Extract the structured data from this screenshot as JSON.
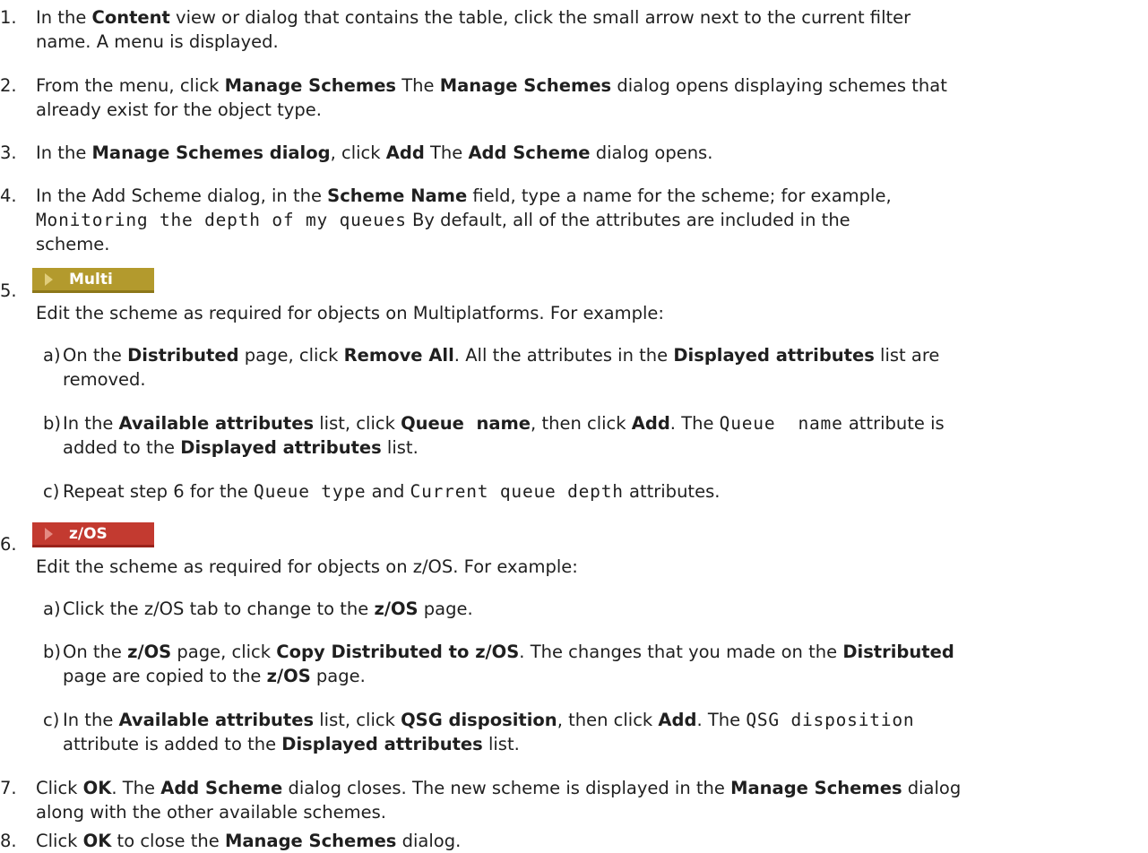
{
  "steps": [
    {
      "number": "1.",
      "lines": [
        [
          {
            "t": "In the "
          },
          {
            "t": "Content",
            "b": true
          },
          {
            "t": " view or dialog that contains the table, click the small arrow next to the current filter"
          }
        ],
        [
          {
            "t": "name. A menu is displayed."
          }
        ]
      ]
    },
    {
      "number": "2.",
      "lines": [
        [
          {
            "t": "From the menu, click "
          },
          {
            "t": "Manage Schemes",
            "b": true
          },
          {
            "t": " The "
          },
          {
            "t": "Manage Schemes",
            "b": true
          },
          {
            "t": " dialog opens displaying schemes that"
          }
        ],
        [
          {
            "t": "already exist for the object type."
          }
        ]
      ]
    },
    {
      "number": "3.",
      "lines": [
        [
          {
            "t": "In the "
          },
          {
            "t": "Manage Schemes dialog",
            "b": true
          },
          {
            "t": ", click "
          },
          {
            "t": "Add",
            "b": true
          },
          {
            "t": " The "
          },
          {
            "t": "Add Scheme",
            "b": true
          },
          {
            "t": " dialog opens."
          }
        ]
      ]
    },
    {
      "number": "4.",
      "lines": [
        [
          {
            "t": "In the Add Scheme dialog, in the "
          },
          {
            "t": "Scheme Name",
            "b": true
          },
          {
            "t": " field, type a name for the scheme; for example,"
          }
        ],
        [
          {
            "t": "Monitoring the depth of my queues",
            "m": true
          },
          {
            "t": " By default, all of the attributes are included in the"
          }
        ],
        [
          {
            "t": "scheme."
          }
        ]
      ]
    }
  ],
  "multi_section": {
    "number": "5.",
    "badge_label": "Multi",
    "badge_color": "#b39a2d",
    "intro": "Edit the scheme as required for objects on Multiplatforms. For example:",
    "substeps": [
      {
        "letter": "a)",
        "lines": [
          [
            {
              "t": "On the "
            },
            {
              "t": "Distributed",
              "b": true
            },
            {
              "t": " page, click "
            },
            {
              "t": "Remove All",
              "b": true
            },
            {
              "t": ". All the attributes in the "
            },
            {
              "t": "Displayed attributes",
              "b": true
            },
            {
              "t": " list are"
            }
          ],
          [
            {
              "t": "removed."
            }
          ]
        ]
      },
      {
        "letter": "b)",
        "lines": [
          [
            {
              "t": "In the "
            },
            {
              "t": "Available attributes",
              "b": true
            },
            {
              "t": " list, click "
            },
            {
              "t": "Queue  name",
              "b": true,
              "pre": true
            },
            {
              "t": ", then click "
            },
            {
              "t": "Add",
              "b": true
            },
            {
              "t": ". The "
            },
            {
              "t": "Queue  name",
              "m": true
            },
            {
              "t": " attribute is"
            }
          ],
          [
            {
              "t": "added to the "
            },
            {
              "t": "Displayed attributes",
              "b": true
            },
            {
              "t": " list."
            }
          ]
        ]
      },
      {
        "letter": "c)",
        "lines": [
          [
            {
              "t": "Repeat step 6 for the "
            },
            {
              "t": "Queue type",
              "m": true
            },
            {
              "t": " and "
            },
            {
              "t": "Current queue depth",
              "m": true
            },
            {
              "t": " attributes."
            }
          ]
        ]
      }
    ]
  },
  "zos_section": {
    "number": "6.",
    "badge_label": "z/OS",
    "badge_color": "#c33a30",
    "intro": "Edit the scheme as required for objects on z/OS. For example:",
    "substeps": [
      {
        "letter": "a)",
        "lines": [
          [
            {
              "t": "Click the z/OS tab to change to the "
            },
            {
              "t": "z/OS",
              "b": true
            },
            {
              "t": " page."
            }
          ]
        ]
      },
      {
        "letter": "b)",
        "lines": [
          [
            {
              "t": "On the "
            },
            {
              "t": "z/OS",
              "b": true
            },
            {
              "t": " page, click "
            },
            {
              "t": "Copy Distributed to z/OS",
              "b": true
            },
            {
              "t": ". The changes that you made on the "
            },
            {
              "t": "Distributed",
              "b": true
            }
          ],
          [
            {
              "t": "page are copied to the "
            },
            {
              "t": "z/OS",
              "b": true
            },
            {
              "t": " page."
            }
          ]
        ]
      },
      {
        "letter": "c)",
        "lines": [
          [
            {
              "t": "In the "
            },
            {
              "t": "Available attributes",
              "b": true
            },
            {
              "t": " list, click "
            },
            {
              "t": "QSG disposition",
              "b": true
            },
            {
              "t": ", then click "
            },
            {
              "t": "Add",
              "b": true
            },
            {
              "t": ". The "
            },
            {
              "t": "QSG disposition",
              "m": true
            }
          ],
          [
            {
              "t": "attribute is added to the "
            },
            {
              "t": "Displayed attributes",
              "b": true
            },
            {
              "t": " list."
            }
          ]
        ]
      }
    ]
  },
  "final_steps": [
    {
      "number": "7.",
      "lines": [
        [
          {
            "t": "Click "
          },
          {
            "t": "OK",
            "b": true
          },
          {
            "t": ". The "
          },
          {
            "t": "Add Scheme",
            "b": true
          },
          {
            "t": " dialog closes. The new scheme is displayed in the "
          },
          {
            "t": "Manage Schemes",
            "b": true
          },
          {
            "t": " dialog"
          }
        ],
        [
          {
            "t": "along with the other available schemes."
          }
        ]
      ]
    },
    {
      "number": "8.",
      "lines": [
        [
          {
            "t": "Click "
          },
          {
            "t": "OK",
            "b": true
          },
          {
            "t": " to close the "
          },
          {
            "t": "Manage Schemes",
            "b": true
          },
          {
            "t": " dialog."
          }
        ]
      ]
    }
  ]
}
